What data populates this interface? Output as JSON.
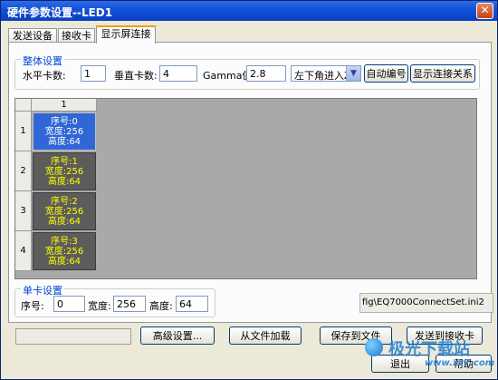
{
  "window": {
    "title": "硬件参数设置--LED1",
    "close_glyph": "✕"
  },
  "tabs": [
    "发送设备",
    "接收卡",
    "显示屏连接"
  ],
  "overall": {
    "legend": "整体设置",
    "h_cards_label": "水平卡数:",
    "h_cards_value": "1",
    "v_cards_label": "垂直卡数:",
    "v_cards_value": "4",
    "gamma_label": "Gamma值:",
    "gamma_value": "2.8",
    "entry_mode": "左下角进入Z",
    "auto_number": "自动编号",
    "show_connection": "显示连接关系"
  },
  "grid": {
    "columns": [
      "1"
    ],
    "rows": [
      "1",
      "2",
      "3",
      "4"
    ],
    "cells": [
      {
        "id": "序号:0",
        "width": "宽度:256",
        "height": "高度:64",
        "selected": true
      },
      {
        "id": "序号:1",
        "width": "宽度:256",
        "height": "高度:64",
        "selected": false
      },
      {
        "id": "序号:2",
        "width": "宽度:256",
        "height": "高度:64",
        "selected": false
      },
      {
        "id": "序号:3",
        "width": "宽度:256",
        "height": "高度:64",
        "selected": false
      }
    ]
  },
  "single": {
    "legend": "单卡设置",
    "seq_label": "序号:",
    "seq_value": "0",
    "width_label": "宽度:",
    "width_value": "256",
    "height_label": "高度:",
    "height_value": "64"
  },
  "config_path": "fig\\EQ7000ConnectSet.ini2",
  "buttons": {
    "advanced": "高级设置...",
    "load_file": "从文件加载",
    "save_file": "保存到文件",
    "send_card": "发送到接收卡",
    "exit": "退出",
    "help": "帮助"
  },
  "watermark": {
    "name": "极光下载站",
    "url": "www.xz7.com"
  },
  "colors": {
    "title_bar": "#1250d8",
    "cell_selected": "#3166d6",
    "cell_text": "#ffff00",
    "legend_text": "#0046d5"
  }
}
